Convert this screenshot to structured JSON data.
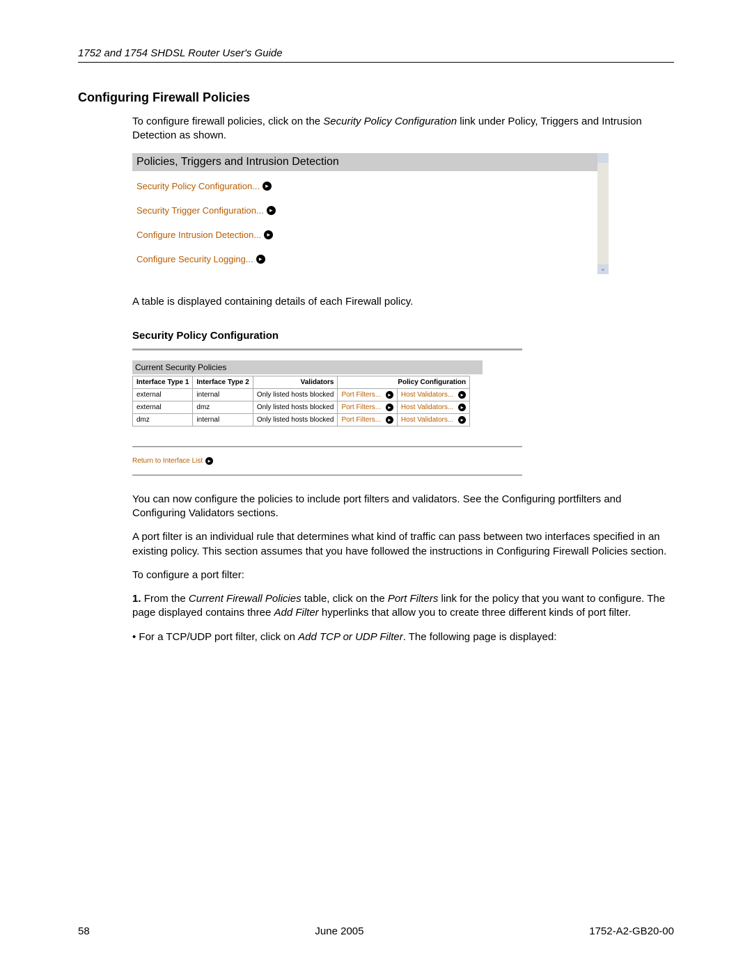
{
  "header": {
    "running_title": "1752 and 1754 SHDSL Router User's Guide"
  },
  "section": {
    "title": "Configuring Firewall Policies",
    "intro_prefix": "To configure firewall policies, click on the ",
    "intro_link": "Security Policy Configuration",
    "intro_suffix": " link under Policy, Triggers and Intrusion Detection as shown."
  },
  "panel1": {
    "title": "Policies, Triggers and Intrusion Detection",
    "links": [
      "Security Policy Configuration...",
      "Security Trigger Configuration...",
      "Configure Intrusion Detection...",
      "Configure Security Logging..."
    ]
  },
  "after_panel1": "A table is displayed containing details of each Firewall policy.",
  "panel2": {
    "title": "Security Policy Configuration",
    "subtitle": "Current Security Policies",
    "headers": {
      "if1": "Interface Type 1",
      "if2": "Interface Type 2",
      "val": "Validators",
      "pol": "Policy Configuration"
    },
    "rows": [
      {
        "if1": "external",
        "if2": "internal",
        "val": "Only listed hosts blocked",
        "pf": "Port Filters...",
        "hv": "Host Validators..."
      },
      {
        "if1": "external",
        "if2": "dmz",
        "val": "Only listed hosts blocked",
        "pf": "Port Filters...",
        "hv": "Host Validators..."
      },
      {
        "if1": "dmz",
        "if2": "internal",
        "val": "Only listed hosts blocked",
        "pf": "Port Filters...",
        "hv": "Host Validators..."
      }
    ],
    "return_link": "Return to Interface List"
  },
  "paras": {
    "p1": "You can now configure the policies to include port filters and validators. See the Configuring portfilters and Configuring Validators sections.",
    "p2": "A port filter is an individual rule that determines what kind of traffic can pass between two interfaces specified in an existing policy. This section assumes that you have followed the instructions in Configuring Firewall Policies section.",
    "p3": "To configure a port filter:",
    "step1_prefix": "1. ",
    "step1_a": "From the ",
    "step1_b": "Current Firewall Policies",
    "step1_c": " table, click on the ",
    "step1_d": "Port Filters",
    "step1_e": " link for the policy that you want to configure. The page displayed contains three ",
    "step1_f": "Add Filter",
    "step1_g": " hyperlinks that allow you to create three different kinds of port filter.",
    "bullet_prefix": "• For a TCP/UDP port filter, click on ",
    "bullet_link": "Add TCP or UDP Filter",
    "bullet_suffix": ". The following page is displayed:"
  },
  "footer": {
    "page": "58",
    "date": "June 2005",
    "docnum": "1752-A2-GB20-00"
  }
}
